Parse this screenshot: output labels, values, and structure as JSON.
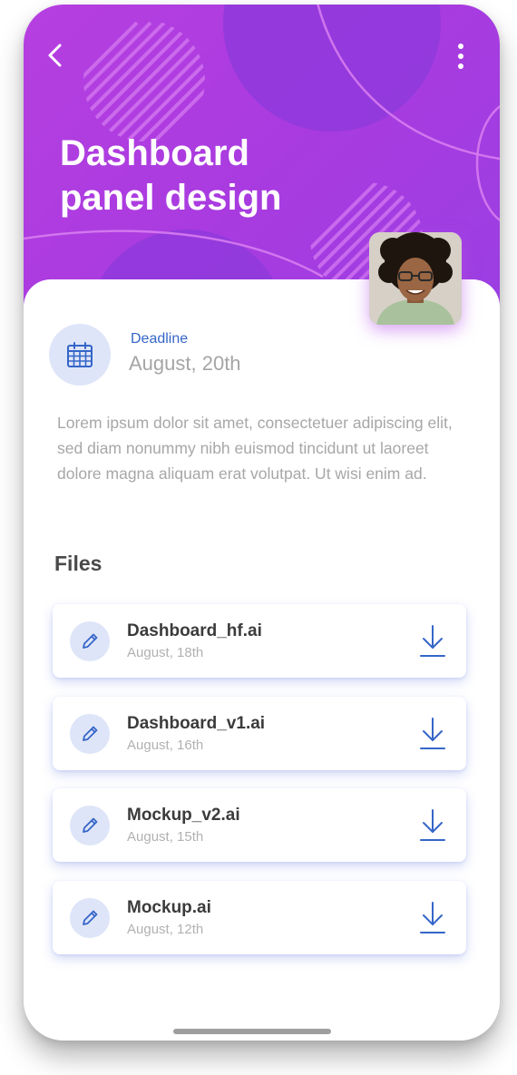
{
  "header": {
    "title_line1": "Dashboard",
    "title_line2": "panel design",
    "back_icon": "chevron-left-icon",
    "more_icon": "more-vertical-icon",
    "gradient_color": "#b03ee0"
  },
  "deadline": {
    "icon": "calendar-icon",
    "label": "Deadline",
    "date": "August, 20th"
  },
  "description": "Lorem ipsum dolor sit amet, consectetuer adipiscing elit, sed diam nonummy nibh euismod tincidunt ut laoreet dolore magna aliquam erat volutpat. Ut wisi enim ad.",
  "files": {
    "heading": "Files",
    "items": [
      {
        "name": "Dashboard_hf.ai",
        "date": "August, 18th"
      },
      {
        "name": "Dashboard_v1.ai",
        "date": "August, 16th"
      },
      {
        "name": "Mockup_v2.ai",
        "date": "August, 15th"
      },
      {
        "name": "Mockup.ai",
        "date": "August, 12th"
      }
    ]
  },
  "colors": {
    "accent_blue": "#3566c8",
    "icon_circle_bg": "#dfe5f8",
    "header_purple": "#b03ee0"
  }
}
